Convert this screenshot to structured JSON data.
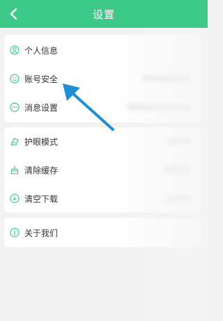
{
  "header": {
    "title": "设置",
    "back_icon": "chevron-left-icon",
    "background": "#3cc98a"
  },
  "groups": [
    {
      "items": [
        {
          "label": "个人信息",
          "icon": "user-circle-icon"
        },
        {
          "label": "账号安全",
          "icon": "smile-circle-icon"
        },
        {
          "label": "消息设置",
          "icon": "chat-dots-icon"
        }
      ]
    },
    {
      "items": [
        {
          "label": "护眼模式",
          "icon": "eye-care-icon"
        },
        {
          "label": "清除缓存",
          "icon": "cleanup-icon"
        },
        {
          "label": "清空下载",
          "icon": "download-clear-icon"
        }
      ]
    },
    {
      "items": [
        {
          "label": "关于我们",
          "icon": "info-circle-icon"
        }
      ]
    }
  ],
  "accent_color": "#3cc98a",
  "annotation_arrow_color": "#1e8fd6"
}
